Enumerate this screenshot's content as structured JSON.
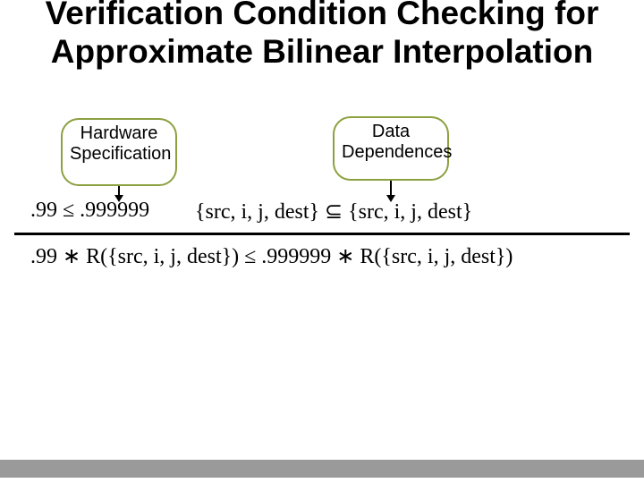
{
  "title": "Verification Condition Checking for Approximate Bilinear Interpolation",
  "bubbles": {
    "left": "Hardware Specification",
    "right": "Data Dependences"
  },
  "inequalities": {
    "left": ".99 ≤ .999999",
    "right": "{src, i, j, dest} ⊆ {src, i, j, dest}"
  },
  "formula": ".99 ∗ R({src, i, j, dest}) ≤ .999999 ∗ R({src, i, j, dest})"
}
